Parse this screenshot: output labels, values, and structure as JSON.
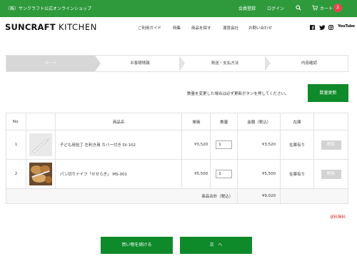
{
  "topbar": {
    "shop_name": "（株）サンクラフト公式オンラインショップ",
    "register": "会員登録",
    "login": "ログイン",
    "cart": "カート",
    "cart_count": "2"
  },
  "header": {
    "logo_main": "SUNCRAFT",
    "logo_sub": "KITCHEN",
    "nav": [
      "ご利用ガイド",
      "特集",
      "商品を探す",
      "運営会社",
      "お問い合わせ"
    ],
    "sns": [
      "f",
      "t",
      "insta",
      "YouTube"
    ]
  },
  "steps": [
    "カート",
    "お客様情報",
    "発送・支払方法",
    "内容確認"
  ],
  "notice": "数量を変更した場合は必ず更新ボタンを押してください。",
  "update_button": "数量更新",
  "table": {
    "headers": [
      "No.",
      "",
      "商品名",
      "単価",
      "数量",
      "金額（税込）",
      "在庫",
      ""
    ],
    "rows": [
      {
        "no": "1",
        "name": "子ども用包丁 左利き用 カバー付き DI-102",
        "price": "¥3,520",
        "qty": "1",
        "amount": "¥3,520",
        "stock": "在庫有り",
        "delete": "削除"
      },
      {
        "no": "2",
        "name": "パン切りナイフ「せせらぎ」 MS-001",
        "price": "¥5,500",
        "qty": "1",
        "amount": "¥5,500",
        "stock": "在庫有り",
        "delete": "削除"
      }
    ],
    "subtotal_label": "商品合計（税込）",
    "subtotal_value": "¥9,020"
  },
  "shipping_note": "送料無料",
  "continue_button": "買い物を続ける",
  "next_button": "次　へ",
  "colors": {
    "brand_green": "#2e9a3c",
    "button_green": "#0f8a2a",
    "badge_red": "#e8474f"
  }
}
